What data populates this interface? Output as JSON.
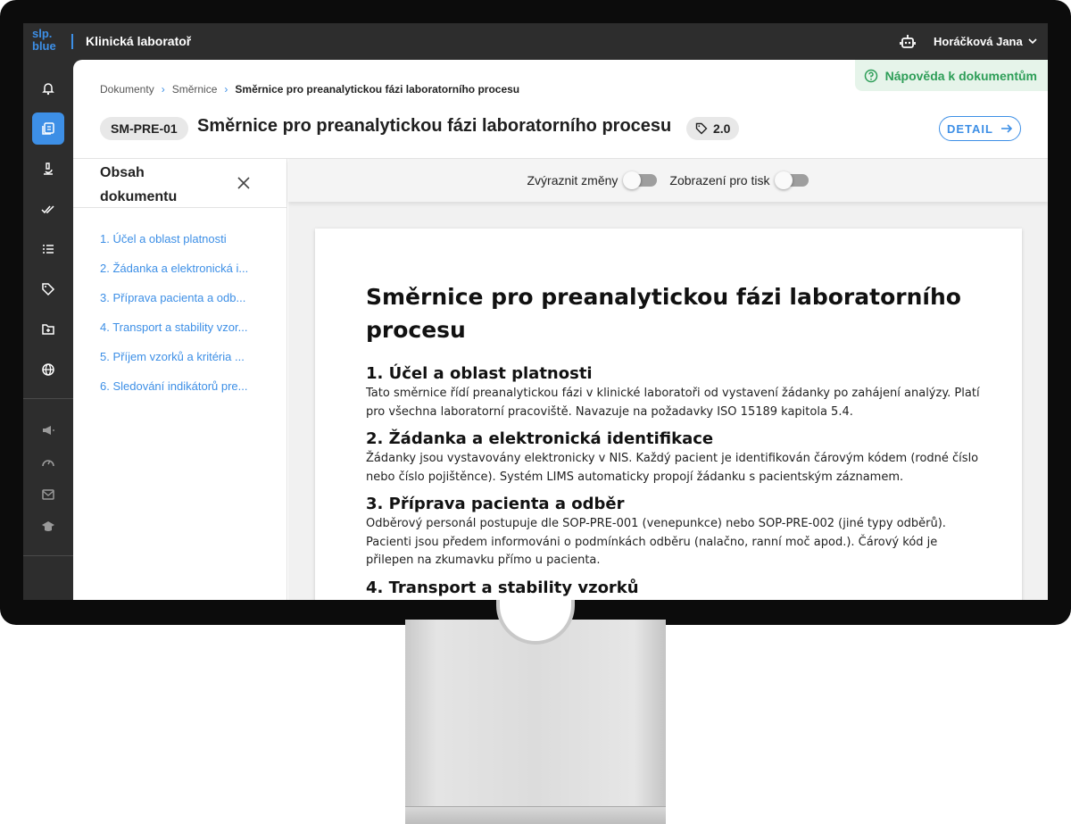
{
  "app": {
    "logo_line1": "slp.",
    "logo_line2": "blue",
    "title": "Klinická laboratoř",
    "user_name": "Horáčková Jana"
  },
  "help": {
    "label": "Nápověda k dokumentům"
  },
  "breadcrumb": {
    "items": [
      "Dokumenty",
      "Směrnice"
    ],
    "current": "Směrnice pro preanalytickou fázi laboratorního procesu"
  },
  "document": {
    "code": "SM-PRE-01",
    "title": "Směrnice pro preanalytickou fázi laboratorního procesu",
    "version": "2.0",
    "detail_label": "DETAIL"
  },
  "toc": {
    "title": "Obsah dokumentu",
    "items": [
      "1. Účel a oblast platnosti",
      "2. Žádanka a elektronická i...",
      "3. Příprava pacienta a odb...",
      "4. Transport a stability vzor...",
      "5. Příjem vzorků a kritéria ...",
      "6. Sledování indikátorů pre..."
    ]
  },
  "toolbar": {
    "highlight_label": "Zvýraznit změny",
    "print_label": "Zobrazení pro tisk"
  },
  "paper": {
    "title": "Směrnice pro preanalytickou fázi laboratorního procesu",
    "sections": [
      {
        "heading": "1. Účel a oblast platnosti",
        "text": "Tato směrnice řídí preanalytickou fázi v klinické laboratoři od vystavení žádanky po zahájení analýzy. Platí pro všechna laboratorní pracoviště. Navazuje na požadavky ISO 15189 kapitola 5.4."
      },
      {
        "heading": "2. Žádanka a elektronická identifikace",
        "text": "Žádanky jsou vystavovány elektronicky v NIS. Každý pacient je identifikován čárovým kódem (rodné číslo nebo číslo pojištěnce). Systém LIMS automaticky propojí žádanku s pacientským záznamem."
      },
      {
        "heading": "3. Příprava pacienta a odběr",
        "text": "Odběrový personál postupuje dle SOP-PRE-001 (venepunkce) nebo SOP-PRE-002 (jiné typy odběrů). Pacienti jsou předem informováni o podmínkách odběru (nalačno, ranní moč apod.). Čárový kód je přilepen na zkumavku přímo u pacienta."
      },
      {
        "heading": "4. Transport a stability vzorků",
        "text": ""
      }
    ]
  }
}
